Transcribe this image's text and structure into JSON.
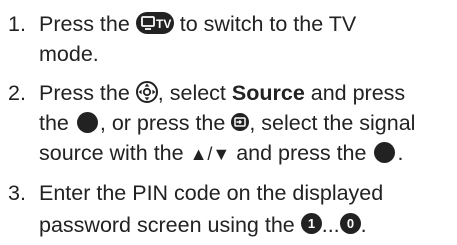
{
  "steps": [
    {
      "num": "1.",
      "lines": [
        [
          "Press the ",
          " to switch to the TV"
        ],
        [
          "mode."
        ]
      ],
      "tv_button_label": "TV"
    },
    {
      "num": "2.",
      "lines": [
        [
          "Press the ",
          ", select ",
          "Source",
          " and press"
        ],
        [
          "the ",
          ", or press the ",
          ", select the signal"
        ],
        [
          "source with the ",
          "▲/▼",
          " and press the ",
          "."
        ]
      ]
    },
    {
      "num": "3.",
      "lines": [
        [
          "Enter the PIN code on the displayed"
        ],
        [
          "password screen using the ",
          "1",
          "...",
          "0",
          "."
        ]
      ]
    }
  ]
}
